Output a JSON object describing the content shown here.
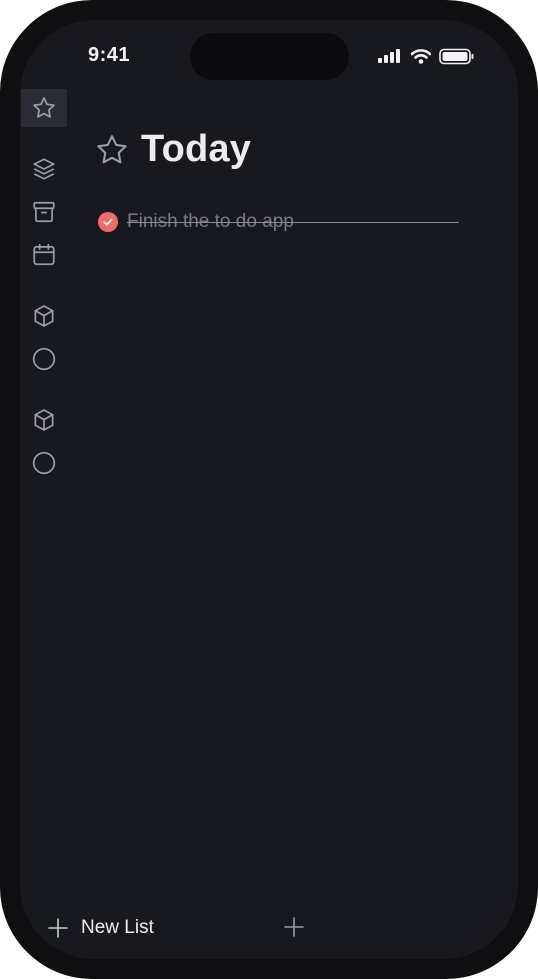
{
  "status_bar": {
    "time": "9:41"
  },
  "sidebar": {
    "items": [
      {
        "id": "today",
        "icon": "star-icon",
        "active": true
      },
      {
        "id": "all",
        "icon": "layers-icon",
        "active": false
      },
      {
        "id": "archive",
        "icon": "archive-icon",
        "active": false
      },
      {
        "id": "calendar",
        "icon": "calendar-icon",
        "active": false
      },
      {
        "id": "list-1",
        "icon": "cube-icon",
        "active": false
      },
      {
        "id": "list-1-circle",
        "icon": "circle-icon",
        "active": false
      },
      {
        "id": "list-2",
        "icon": "cube-icon",
        "active": false
      },
      {
        "id": "list-2-circle",
        "icon": "circle-icon",
        "active": false
      }
    ]
  },
  "main": {
    "title": "Today",
    "tasks": [
      {
        "text": "Finish the to do app",
        "completed": true
      }
    ]
  },
  "footer": {
    "new_list_label": "New List"
  },
  "colors": {
    "background": "#18191e",
    "frame": "#0f0f12",
    "accent_check": "#f26a6a",
    "text_primary": "#ececee",
    "text_muted": "#7b7c83",
    "active_item_bg": "#2b2c33"
  }
}
